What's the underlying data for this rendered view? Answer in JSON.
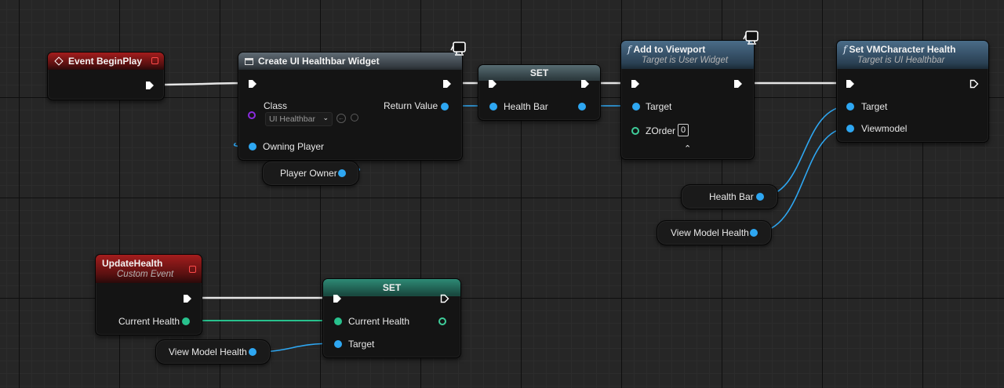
{
  "colors": {
    "exec_wire": "#e6e6e6",
    "object_pin": "#2ea7f2",
    "float_pin": "#28c18d",
    "class_pin": "#8b2be0",
    "event_header": "#a41d1d"
  },
  "nodes": {
    "begin_play": {
      "title": "Event BeginPlay"
    },
    "create_widget": {
      "title": "Create UI Healthbar Widget",
      "class_label": "Class",
      "class_value": "UI Healthbar",
      "owning_player_label": "Owning Player",
      "return_label": "Return Value"
    },
    "set_health_bar": {
      "title": "SET",
      "pin_label": "Health Bar"
    },
    "add_to_viewport": {
      "title": "Add to Viewport",
      "subtitle": "Target is User Widget",
      "target_label": "Target",
      "zorder_label": "ZOrder",
      "zorder_value": "0"
    },
    "set_vm_health": {
      "title": "Set VMCharacter Health",
      "subtitle": "Target is UI Healthbar",
      "target_label": "Target",
      "viewmodel_label": "Viewmodel"
    },
    "update_health": {
      "title": "UpdateHealth",
      "subtitle": "Custom Event",
      "output_label": "Current Health"
    },
    "set_current_health": {
      "title": "SET",
      "current_health_label": "Current Health",
      "target_label": "Target"
    }
  },
  "variables": {
    "player_owner": "Player Owner",
    "health_bar": "Health Bar",
    "view_model_health_top": "View Model Health",
    "view_model_health_bottom": "View Model Health"
  },
  "icons": {
    "function": "f",
    "event": "event-diamond-icon",
    "class": "widget-icon",
    "server_only": "monitor-icon"
  }
}
